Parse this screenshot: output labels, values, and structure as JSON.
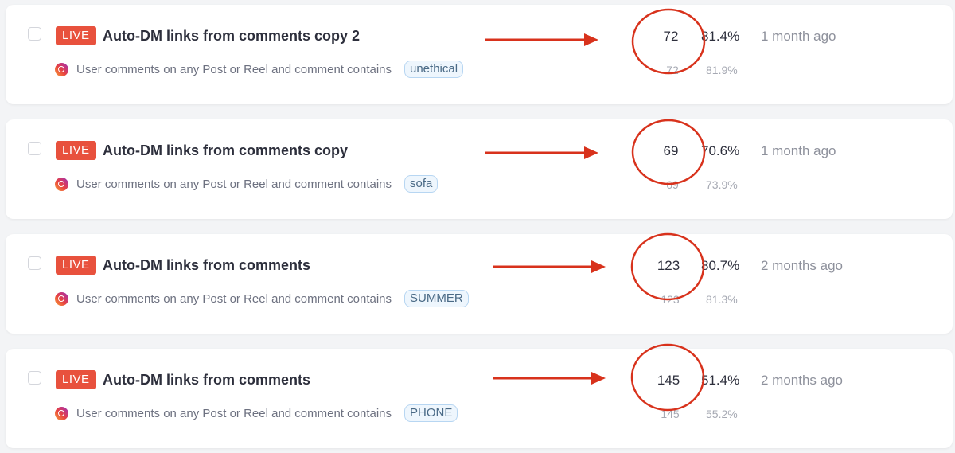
{
  "automations": [
    {
      "status": "LIVE",
      "title": "Auto-DM links from comments copy 2",
      "trigger": "User comments on any Post or Reel and comment contains",
      "keyword": "unethical",
      "count": "72",
      "count_sub": "72",
      "rate": "81.4%",
      "rate_sub": "81.9%",
      "updated": "1 month ago"
    },
    {
      "status": "LIVE",
      "title": "Auto-DM links from comments copy",
      "trigger": "User comments on any Post or Reel and comment contains",
      "keyword": "sofa",
      "count": "69",
      "count_sub": "69",
      "rate": "70.6%",
      "rate_sub": "73.9%",
      "updated": "1 month ago"
    },
    {
      "status": "LIVE",
      "title": "Auto-DM links from comments",
      "trigger": "User comments on any Post or Reel and comment contains",
      "keyword": "SUMMER",
      "count": "123",
      "count_sub": "123",
      "rate": "80.7%",
      "rate_sub": "81.3%",
      "updated": "2 months ago"
    },
    {
      "status": "LIVE",
      "title": "Auto-DM links from comments",
      "trigger": "User comments on any Post or Reel and comment contains",
      "keyword": "PHONE",
      "count": "145",
      "count_sub": "145",
      "rate": "51.4%",
      "rate_sub": "55.2%",
      "updated": "2 months ago"
    }
  ],
  "colors": {
    "live_badge": "#e8513d",
    "annotation": "#d8321c",
    "keyword_bg": "#eef6fd",
    "keyword_border": "#b7d6f2"
  }
}
